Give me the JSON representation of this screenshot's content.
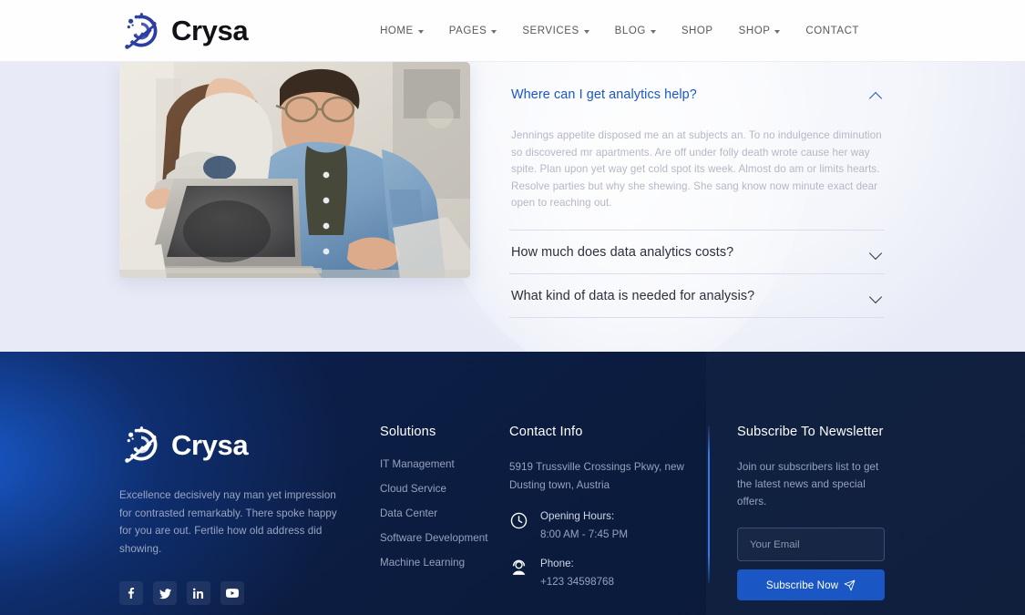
{
  "brand": {
    "name": "Crysa",
    "logo_icon": "analytics-orbit-icon"
  },
  "header": {
    "nav": [
      {
        "label": "HOME",
        "has_dropdown": true
      },
      {
        "label": "PAGES",
        "has_dropdown": true
      },
      {
        "label": "SERVICES",
        "has_dropdown": true
      },
      {
        "label": "BLOG",
        "has_dropdown": true
      },
      {
        "label": "SHOP",
        "has_dropdown": false
      },
      {
        "label": "SHOP",
        "has_dropdown": true
      },
      {
        "label": "CONTACT",
        "has_dropdown": false
      }
    ]
  },
  "main": {
    "image_alt": "Two colleagues reviewing analytics on a laptop",
    "faq": [
      {
        "question": "Where can I get analytics help?",
        "answer": "Jennings appetite disposed me an at subjects an. To no indulgence diminution so discovered mr apartments. Are off under folly death wrote cause her way spite. Plan upon yet way get cold spot its week. Almost do am or limits hearts. Resolve parties but why she shewing. She sang know now minute exact dear open to reaching out.",
        "expanded": true,
        "chevron_icon": "chevron-up-icon"
      },
      {
        "question": "How much does data analytics costs?",
        "answer": "",
        "expanded": false,
        "chevron_icon": "chevron-down-icon"
      },
      {
        "question": "What kind of data is needed for analysis?",
        "answer": "",
        "expanded": false,
        "chevron_icon": "chevron-down-icon"
      }
    ]
  },
  "footer": {
    "about": {
      "description": "Excellence decisively nay man yet impression for contrasted remarkably. There spoke happy for you are out. Fertile how old address did showing.",
      "socials": [
        {
          "name": "facebook",
          "icon": "facebook-icon"
        },
        {
          "name": "twitter",
          "icon": "twitter-icon"
        },
        {
          "name": "linkedin",
          "icon": "linkedin-icon"
        },
        {
          "name": "youtube",
          "icon": "youtube-icon"
        }
      ]
    },
    "solutions": {
      "title": "Solutions",
      "links": [
        "IT Management",
        "Cloud Service",
        "Data Center",
        "Software Development",
        "Machine Learning"
      ]
    },
    "contact": {
      "title": "Contact Info",
      "address": "5919 Trussville Crossings Pkwy, new Dusting town, Austria",
      "hours_label": "Opening Hours:",
      "hours_value": "8:00 AM - 7:45 PM",
      "hours_icon": "clock-icon",
      "phone_label": "Phone:",
      "phone_value": "+123 34598768",
      "phone_icon": "support-agent-icon"
    },
    "newsletter": {
      "title": "Subscribe To Newsletter",
      "description": "Join our subscribers list to get the latest news and special offers.",
      "input_placeholder": "Your Email",
      "input_value": "",
      "button_label": "Subscribe Now",
      "button_icon": "paper-plane-icon"
    }
  },
  "colors": {
    "accent_blue": "#1a56c4",
    "link_blue": "#3a78e8",
    "footer_navy": "#0b1b3c",
    "main_bg": "#e8ebf7",
    "muted_text": "#96a2bf"
  }
}
